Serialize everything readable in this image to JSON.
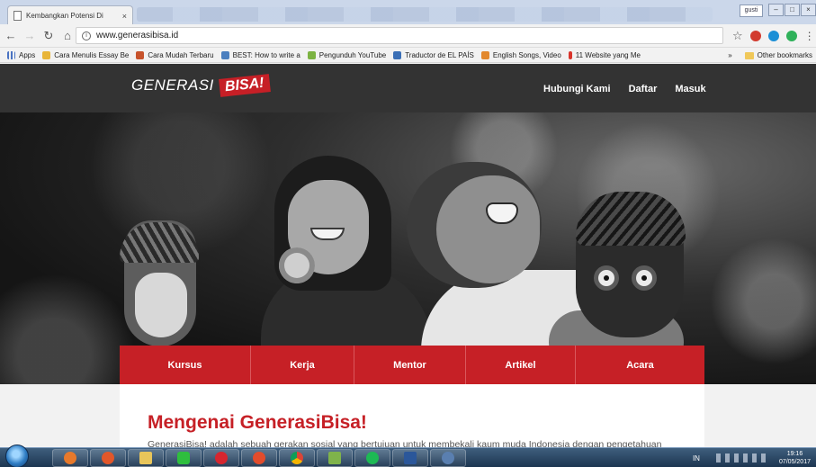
{
  "browser": {
    "tab_title": "Kembangkan Potensi Di",
    "tab_close": "×",
    "user_chip": "gusti",
    "url": "www.generasibisa.id",
    "bookmarks": [
      "Apps",
      "Cara Menulis Essay Be",
      "Cara Mudah Terbaru",
      "BEST: How to write a",
      "Pengunduh YouTube",
      "Traductor de EL PAÍS",
      "English Songs, Video",
      "11 Website yang Me"
    ],
    "bookmarks_overflow": "»",
    "other_bookmarks": "Other bookmarks"
  },
  "site": {
    "logo_text": "GENERASI",
    "logo_badge": "BISA!",
    "top_nav": [
      "Hubungi Kami",
      "Daftar",
      "Masuk"
    ],
    "categories": [
      "Kursus",
      "Kerja",
      "Mentor",
      "Artikel",
      "Acara"
    ],
    "about_title": "Mengenai GenerasiBisa!",
    "about_text": "GenerasiBisa! adalah sebuah gerakan sosial yang bertujuan untuk membekali kaum muda Indonesia dengan pengetahuan"
  },
  "taskbar": {
    "lang": "IN",
    "time": "19:16",
    "date": "07/05/2017"
  },
  "colors": {
    "brand_red": "#c62026",
    "header_bg": "#333333"
  }
}
